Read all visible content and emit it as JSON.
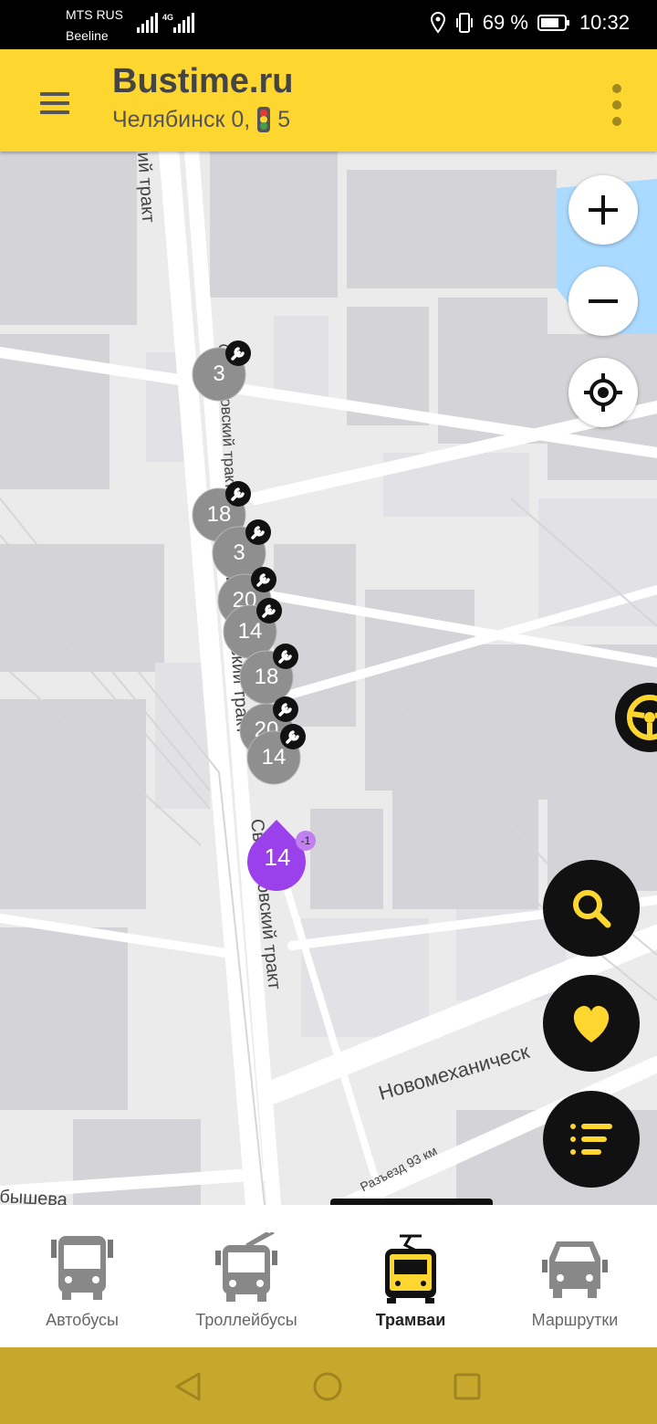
{
  "status": {
    "carrier1": "MTS RUS",
    "carrier2": "Beeline",
    "network": "4G",
    "battery": "69 %",
    "time": "10:32"
  },
  "appbar": {
    "title": "Bustime.ru",
    "city": "Челябинск 0,",
    "traffic_value": "5",
    "menu_icon": "hamburger-menu-icon",
    "more_icon": "kebab-menu-icon"
  },
  "map": {
    "streets": {
      "street1": "Свердловский тракт",
      "street2": "Свердловский тракт",
      "street3": "Свердловский тракт",
      "street4": "ий тракт",
      "street5": "Новомеханическ",
      "street6": "Разъезд 93 км",
      "street7": "бышева"
    },
    "vehicles": [
      {
        "route": "3",
        "status": "repair"
      },
      {
        "route": "18",
        "status": "repair"
      },
      {
        "route": "3",
        "status": "repair"
      },
      {
        "route": "20",
        "status": "repair"
      },
      {
        "route": "14",
        "status": "repair"
      },
      {
        "route": "18",
        "status": "repair"
      },
      {
        "route": "20",
        "status": "repair"
      },
      {
        "route": "14",
        "status": "repair"
      }
    ],
    "active_vehicle": {
      "route": "14",
      "badge": "-1"
    },
    "controls": {
      "zoom_in": "plus-icon",
      "zoom_out": "minus-icon",
      "locate": "crosshair-icon"
    },
    "fabs": {
      "search": "search-icon",
      "favorites": "heart-icon",
      "list": "list-icon",
      "wheel": "steering-wheel-icon"
    }
  },
  "bottom_nav": {
    "items": [
      {
        "label": "Автобусы",
        "icon": "bus-icon"
      },
      {
        "label": "Троллейбусы",
        "icon": "trolleybus-icon"
      },
      {
        "label": "Трамваи",
        "icon": "tram-icon"
      },
      {
        "label": "Маршрутки",
        "icon": "minibus-icon"
      }
    ],
    "active_index": 2
  },
  "colors": {
    "accent": "#fdd630",
    "active_vehicle": "#9b41eb",
    "vehicle": "#8f8f8f",
    "system_nav": "#c8a82c"
  }
}
